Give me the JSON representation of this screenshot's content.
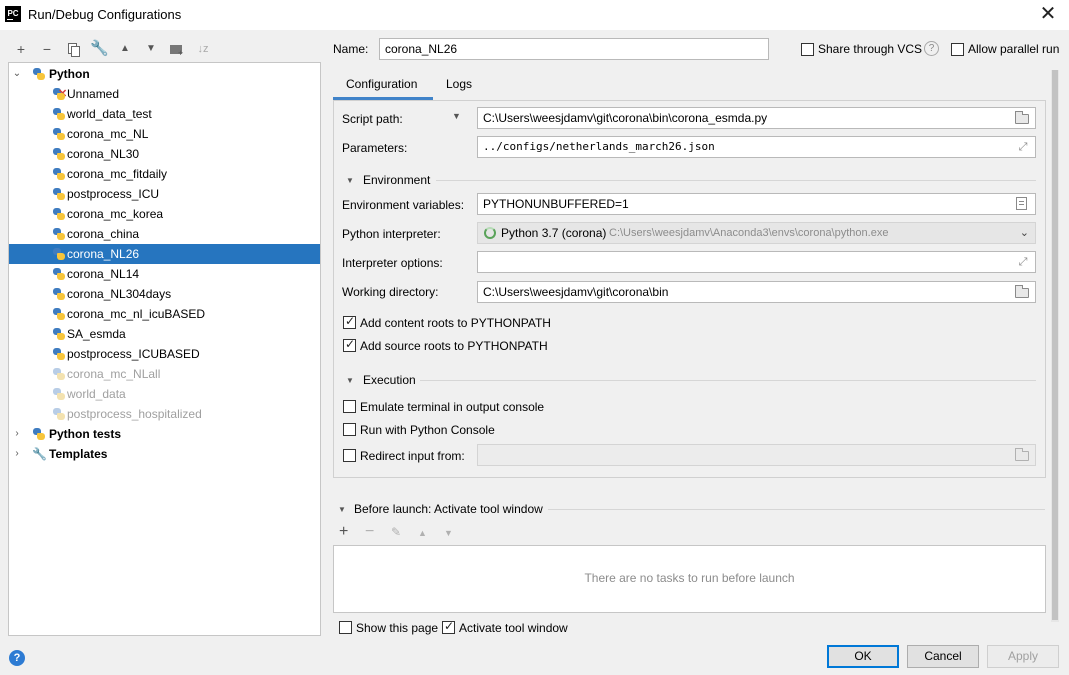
{
  "window": {
    "title": "Run/Debug Configurations",
    "app_icon_text": "PC"
  },
  "toolbar": {
    "icons": [
      "add-icon",
      "remove-icon",
      "copy-icon",
      "wrench-icon",
      "move-up-icon",
      "move-down-icon",
      "new-folder-icon",
      "sort-icon"
    ]
  },
  "tree": {
    "groups": [
      {
        "label": "Python"
      },
      {
        "label": "Python tests"
      },
      {
        "label": "Templates"
      }
    ],
    "items": [
      {
        "label": "Unnamed"
      },
      {
        "label": "world_data_test"
      },
      {
        "label": "corona_mc_NL"
      },
      {
        "label": "corona_NL30"
      },
      {
        "label": "corona_mc_fitdaily"
      },
      {
        "label": "postprocess_ICU"
      },
      {
        "label": "corona_mc_korea"
      },
      {
        "label": "corona_china"
      },
      {
        "label": "corona_NL26"
      },
      {
        "label": "corona_NL14"
      },
      {
        "label": "corona_NL304days"
      },
      {
        "label": "corona_mc_nl_icuBASED"
      },
      {
        "label": "SA_esmda"
      },
      {
        "label": "postprocess_ICUBASED"
      },
      {
        "label": "corona_mc_NLall"
      },
      {
        "label": "world_data"
      },
      {
        "label": "postprocess_hospitalized"
      }
    ],
    "selected": "corona_NL26"
  },
  "header": {
    "name_label": "Name:",
    "name_value": "corona_NL26",
    "share_vcs_label": "Share through VCS",
    "share_vcs_checked": false,
    "help_glyph": "?",
    "allow_parallel_label": "Allow parallel run",
    "allow_parallel_checked": false
  },
  "tabs": [
    {
      "label": "Configuration",
      "active": true
    },
    {
      "label": "Logs",
      "active": false
    }
  ],
  "config": {
    "script_path_label": "Script path:",
    "script_path_value": "C:\\Users\\weesjdamv\\git\\corona\\bin\\corona_esmda.py",
    "parameters_label": "Parameters:",
    "parameters_value": "../configs/netherlands_march26.json",
    "environment_section": "Environment",
    "env_vars_label": "Environment variables:",
    "env_vars_value": "PYTHONUNBUFFERED=1",
    "interpreter_label": "Python interpreter:",
    "interpreter_name": "Python 3.7 (corona)",
    "interpreter_path": "C:\\Users\\weesjdamv\\Anaconda3\\envs\\corona\\python.exe",
    "interpreter_options_label": "Interpreter options:",
    "interpreter_options_value": "",
    "working_dir_label": "Working directory:",
    "working_dir_value": "C:\\Users\\weesjdamv\\git\\corona\\bin",
    "content_roots_label": "Add content roots to PYTHONPATH",
    "content_roots_checked": true,
    "source_roots_label": "Add source roots to PYTHONPATH",
    "source_roots_checked": true,
    "execution_section": "Execution",
    "emulate_terminal_label": "Emulate terminal in output console",
    "emulate_terminal_checked": false,
    "python_console_label": "Run with Python Console",
    "python_console_checked": false,
    "redirect_input_label": "Redirect input from:",
    "redirect_input_checked": false,
    "redirect_input_value": ""
  },
  "before_launch": {
    "title": "Before launch: Activate tool window",
    "empty_text": "There are no tasks to run before launch",
    "show_page_label": "Show this page",
    "show_page_checked": false,
    "activate_label": "Activate tool window",
    "activate_checked": true
  },
  "buttons": {
    "ok": "OK",
    "cancel": "Cancel",
    "apply": "Apply",
    "help_glyph": "?"
  },
  "colors": {
    "selection": "#2675bf",
    "accent": "#0078d7",
    "tab_underline": "#4083c9"
  }
}
